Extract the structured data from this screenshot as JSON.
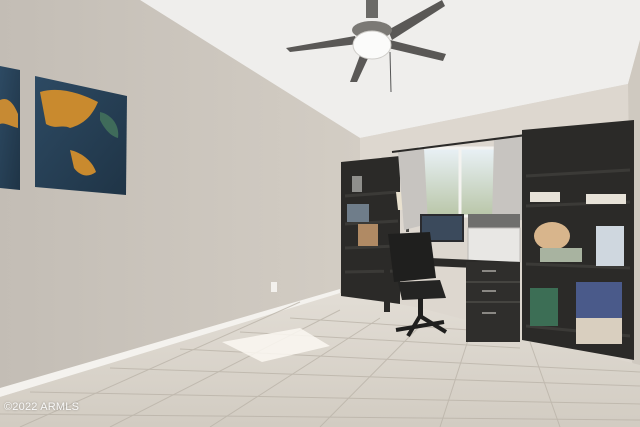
{
  "photo": {
    "watermark": "©2022 ARMLS"
  },
  "colors": {
    "left_wall": "#c9c3bb",
    "back_wall": "#dcd6cd",
    "ceiling": "#f2f1ef",
    "floor_tile": "#d8d2c8",
    "furniture": "#2b2a28",
    "baseboard": "#f4f2ee"
  },
  "icons": [
    "ceiling-fan-icon",
    "world-map-canvas",
    "office-chair",
    "bookshelf",
    "desk",
    "printer",
    "monitor",
    "window",
    "curtain",
    "table-lamp"
  ]
}
